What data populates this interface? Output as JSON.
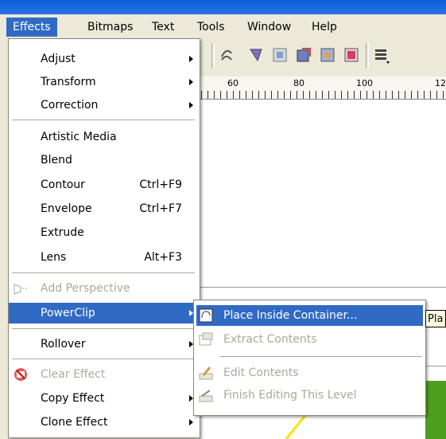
{
  "menubar": {
    "items": [
      {
        "label": "Effects",
        "active": true
      },
      {
        "label": "Bitmaps",
        "active": false
      },
      {
        "label": "Text",
        "active": false
      },
      {
        "label": "Tools",
        "active": false
      },
      {
        "label": "Window",
        "active": false
      },
      {
        "label": "Help",
        "active": false
      }
    ]
  },
  "ruler": {
    "ticks": [
      "60",
      "80",
      "100",
      "12"
    ]
  },
  "effects_menu": {
    "items": [
      {
        "label": "Adjust",
        "submenu": true
      },
      {
        "label": "Transform",
        "submenu": true
      },
      {
        "label": "Correction",
        "submenu": true
      },
      {
        "label": "Artistic Media"
      },
      {
        "label": "Blend"
      },
      {
        "label": "Contour",
        "shortcut": "Ctrl+F9"
      },
      {
        "label": "Envelope",
        "shortcut": "Ctrl+F7"
      },
      {
        "label": "Extrude"
      },
      {
        "label": "Lens",
        "shortcut": "Alt+F3"
      },
      {
        "label": "Add Perspective",
        "disabled": true,
        "icon": "perspective-icon"
      },
      {
        "label": "PowerClip",
        "submenu": true,
        "highlighted": true
      },
      {
        "label": "Rollover",
        "submenu": true
      },
      {
        "label": "Clear Effect",
        "disabled": true,
        "icon": "clear-effect-icon"
      },
      {
        "label": "Copy Effect",
        "submenu": true
      },
      {
        "label": "Clone Effect",
        "submenu": true
      }
    ]
  },
  "powerclip_menu": {
    "items": [
      {
        "label": "Place Inside Container...",
        "highlighted": true,
        "icon": "place-inside-icon"
      },
      {
        "label": "Extract Contents",
        "disabled": true,
        "icon": "extract-contents-icon"
      },
      {
        "label": "Edit Contents",
        "disabled": true,
        "icon": "edit-contents-icon"
      },
      {
        "label": "Finish Editing This Level",
        "disabled": true,
        "icon": "finish-editing-icon"
      }
    ]
  },
  "tooltip": {
    "text": "Pla"
  },
  "colors": {
    "highlight": "#316ac5",
    "menu_bg": "#ffffff",
    "disabled": "#aca899",
    "title_blue": "#0a5ed8"
  }
}
